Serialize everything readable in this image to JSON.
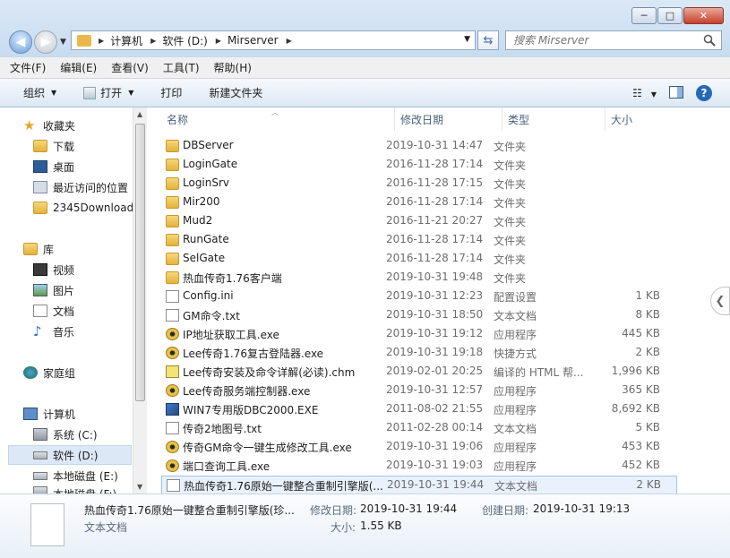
{
  "window": {
    "address_crumbs": [
      "计算机",
      "软件 (D:)",
      "Mirserver"
    ],
    "search_placeholder": "搜索 Mirserver",
    "caption": {
      "minimize": "─",
      "maximize": "□",
      "close": "✕"
    }
  },
  "menubar": [
    "文件(F)",
    "编辑(E)",
    "查看(V)",
    "工具(T)",
    "帮助(H)"
  ],
  "toolbar": {
    "organize": "组织",
    "open": "打开",
    "print": "打印",
    "new_folder": "新建文件夹"
  },
  "nav": {
    "favorites": {
      "label": "收藏夹",
      "items": [
        "下载",
        "桌面",
        "最近访问的位置",
        "2345Downloads"
      ]
    },
    "libraries": {
      "label": "库",
      "items": [
        "视频",
        "图片",
        "文档",
        "音乐"
      ]
    },
    "homegroup": "家庭组",
    "computer": {
      "label": "计算机",
      "items": [
        "系统 (C:)",
        "软件 (D:)",
        "本地磁盘 (E:)",
        "本地磁盘 (F:)"
      ]
    },
    "selected": "软件 (D:)"
  },
  "columns": {
    "name": "名称",
    "date": "修改日期",
    "type": "类型",
    "size": "大小"
  },
  "files": [
    {
      "name": "DBServer",
      "date": "2019-10-31 14:47",
      "type": "文件夹",
      "size": "",
      "icon": "folder-icon"
    },
    {
      "name": "LoginGate",
      "date": "2016-11-28 17:14",
      "type": "文件夹",
      "size": "",
      "icon": "folder-icon"
    },
    {
      "name": "LoginSrv",
      "date": "2016-11-28 17:15",
      "type": "文件夹",
      "size": "",
      "icon": "folder-icon"
    },
    {
      "name": "Mir200",
      "date": "2016-11-28 17:14",
      "type": "文件夹",
      "size": "",
      "icon": "folder-icon"
    },
    {
      "name": "Mud2",
      "date": "2016-11-21 20:27",
      "type": "文件夹",
      "size": "",
      "icon": "folder-icon"
    },
    {
      "name": "RunGate",
      "date": "2016-11-28 17:14",
      "type": "文件夹",
      "size": "",
      "icon": "folder-icon"
    },
    {
      "name": "SelGate",
      "date": "2016-11-28 17:14",
      "type": "文件夹",
      "size": "",
      "icon": "folder-icon"
    },
    {
      "name": "热血传奇1.76客户端",
      "date": "2019-10-31 19:48",
      "type": "文件夹",
      "size": "",
      "icon": "folder-icon"
    },
    {
      "name": "Config.ini",
      "date": "2019-10-31 12:23",
      "type": "配置设置",
      "size": "1 KB",
      "icon": "config-file-icon"
    },
    {
      "name": "GM命令.txt",
      "date": "2019-10-31 18:50",
      "type": "文本文档",
      "size": "8 KB",
      "icon": "text-file-icon"
    },
    {
      "name": "IP地址获取工具.exe",
      "date": "2019-10-31 19:12",
      "type": "应用程序",
      "size": "445 KB",
      "icon": "exe-icon"
    },
    {
      "name": "Lee传奇1.76复古登陆器.exe",
      "date": "2019-10-31 19:18",
      "type": "快捷方式",
      "size": "2 KB",
      "icon": "shortcut-icon"
    },
    {
      "name": "Lee传奇安装及命令详解(必读).chm",
      "date": "2019-02-01 20:25",
      "type": "编译的 HTML 帮...",
      "size": "1,996 KB",
      "icon": "help-file-icon"
    },
    {
      "name": "Lee传奇服务端控制器.exe",
      "date": "2019-10-31 12:57",
      "type": "应用程序",
      "size": "365 KB",
      "icon": "exe-icon"
    },
    {
      "name": "WIN7专用版DBC2000.EXE",
      "date": "2011-08-02 21:55",
      "type": "应用程序",
      "size": "8,692 KB",
      "icon": "windows-app-icon"
    },
    {
      "name": "传奇2地图号.txt",
      "date": "2011-02-28 00:14",
      "type": "文本文档",
      "size": "5 KB",
      "icon": "text-file-icon"
    },
    {
      "name": "传奇GM命令一键生成修改工具.exe",
      "date": "2019-10-31 19:06",
      "type": "应用程序",
      "size": "453 KB",
      "icon": "exe-icon"
    },
    {
      "name": "端口查询工具.exe",
      "date": "2019-10-31 19:03",
      "type": "应用程序",
      "size": "452 KB",
      "icon": "exe-icon"
    },
    {
      "name": "热血传奇1.76原始一键整合重制引擎版(...",
      "date": "2019-10-31 19:44",
      "type": "文本文档",
      "size": "2 KB",
      "icon": "text-file-icon"
    }
  ],
  "selected_index": 18,
  "details": {
    "name": "热血传奇1.76原始一键整合重制引擎版(珍...",
    "type": "文本文档",
    "modified_label": "修改日期:",
    "modified": "2019-10-31 19:44",
    "created_label": "创建日期:",
    "created": "2019-10-31 19:13",
    "size_label": "大小:",
    "size": "1.55 KB"
  }
}
